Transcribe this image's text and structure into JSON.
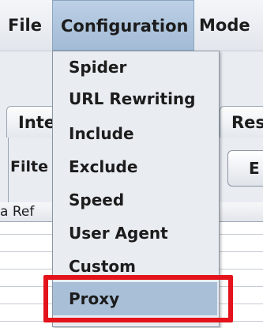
{
  "menubar": {
    "items": [
      {
        "label": "File"
      },
      {
        "label": "Configuration"
      },
      {
        "label": "Mode"
      }
    ]
  },
  "tabs": {
    "left_partial": "Inte",
    "right_partial": "Res"
  },
  "filter": {
    "label": "Filte"
  },
  "button": {
    "label": "E"
  },
  "table": {
    "header_partial": "a Ref"
  },
  "dropdown": {
    "items": [
      {
        "label": "Spider"
      },
      {
        "label": "URL Rewriting"
      },
      {
        "label": "Include"
      },
      {
        "label": "Exclude"
      },
      {
        "label": "Speed"
      },
      {
        "label": "User Agent"
      },
      {
        "label": "Custom"
      },
      {
        "label": "Proxy",
        "selected": true
      }
    ]
  },
  "colors": {
    "highlight": "#e3121b",
    "selection": "#a9bfd8"
  }
}
